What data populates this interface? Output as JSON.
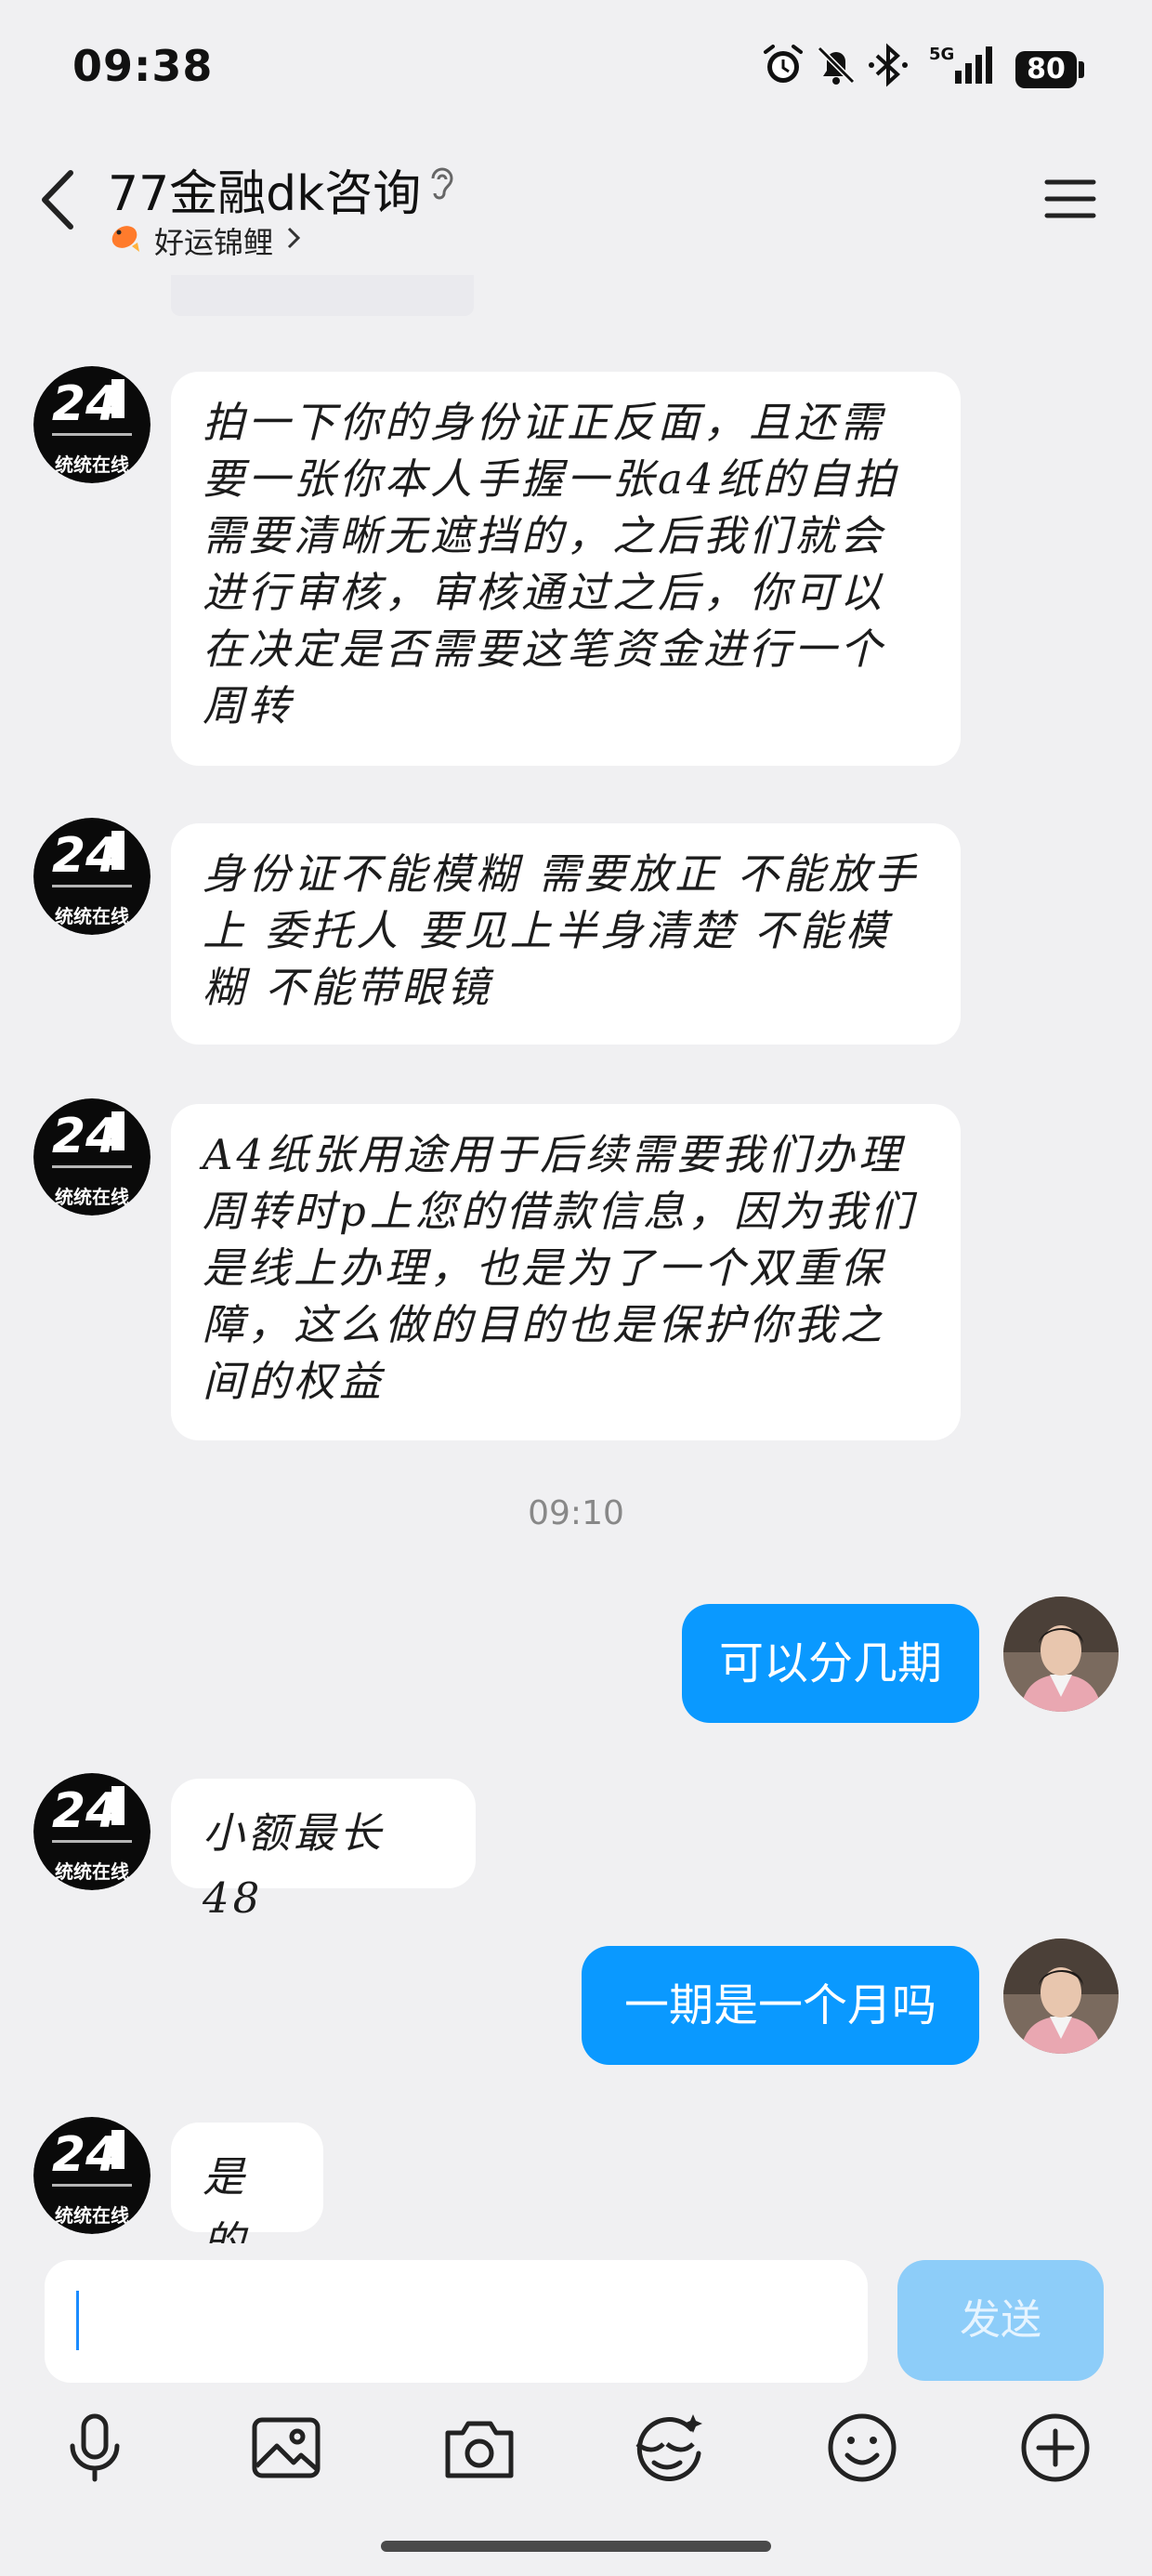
{
  "status_bar": {
    "time": "09:38",
    "battery": "80",
    "network": "5G",
    "icons": [
      "alarm-icon",
      "mute-bell-icon",
      "bluetooth-icon",
      "signal-5g-icon",
      "battery-icon"
    ]
  },
  "header": {
    "title": "77金融dk咨询",
    "subtitle": "好运锦鲤",
    "icons": [
      "back-icon",
      "ear-icon",
      "koi-emoji-icon",
      "chevron-right-icon",
      "menu-icon"
    ]
  },
  "messages": [
    {
      "side": "in",
      "text": "拍一下你的身份证正反面，且还需要一张你本人手握一张a4纸的自拍 需要清晰无遮挡的，之后我们就会进行审核，审核通过之后，你可以在决定是否需要这笔资金进行一个周转"
    },
    {
      "side": "in",
      "text": "身份证不能模糊 需要放正 不能放手上 委托人 要见上半身清楚 不能模糊 不能带眼镜"
    },
    {
      "side": "in",
      "text": "A4纸张用途用于后续需要我们办理周转时p上您的借款信息，因为我们是线上办理，也是为了一个双重保障，这么做的目的也是保护你我之间的权益"
    },
    {
      "side": "time",
      "text": "09:10"
    },
    {
      "side": "out",
      "text": "可以分几期"
    },
    {
      "side": "in",
      "text": "小额最长48"
    },
    {
      "side": "out",
      "text": "一期是一个月吗"
    },
    {
      "side": "in",
      "text": "是的"
    }
  ],
  "bot_avatar": {
    "badge": "24",
    "caption": "统统在线"
  },
  "composer": {
    "input_value": "",
    "send_label": "发送"
  },
  "toolbar": [
    "microphone-icon",
    "image-icon",
    "camera-icon",
    "sticker-face-icon",
    "emoji-icon",
    "plus-icon"
  ],
  "colors": {
    "accent": "#0a99ff",
    "send_disabled": "#8dcdf9",
    "background": "#f0f0f2"
  }
}
